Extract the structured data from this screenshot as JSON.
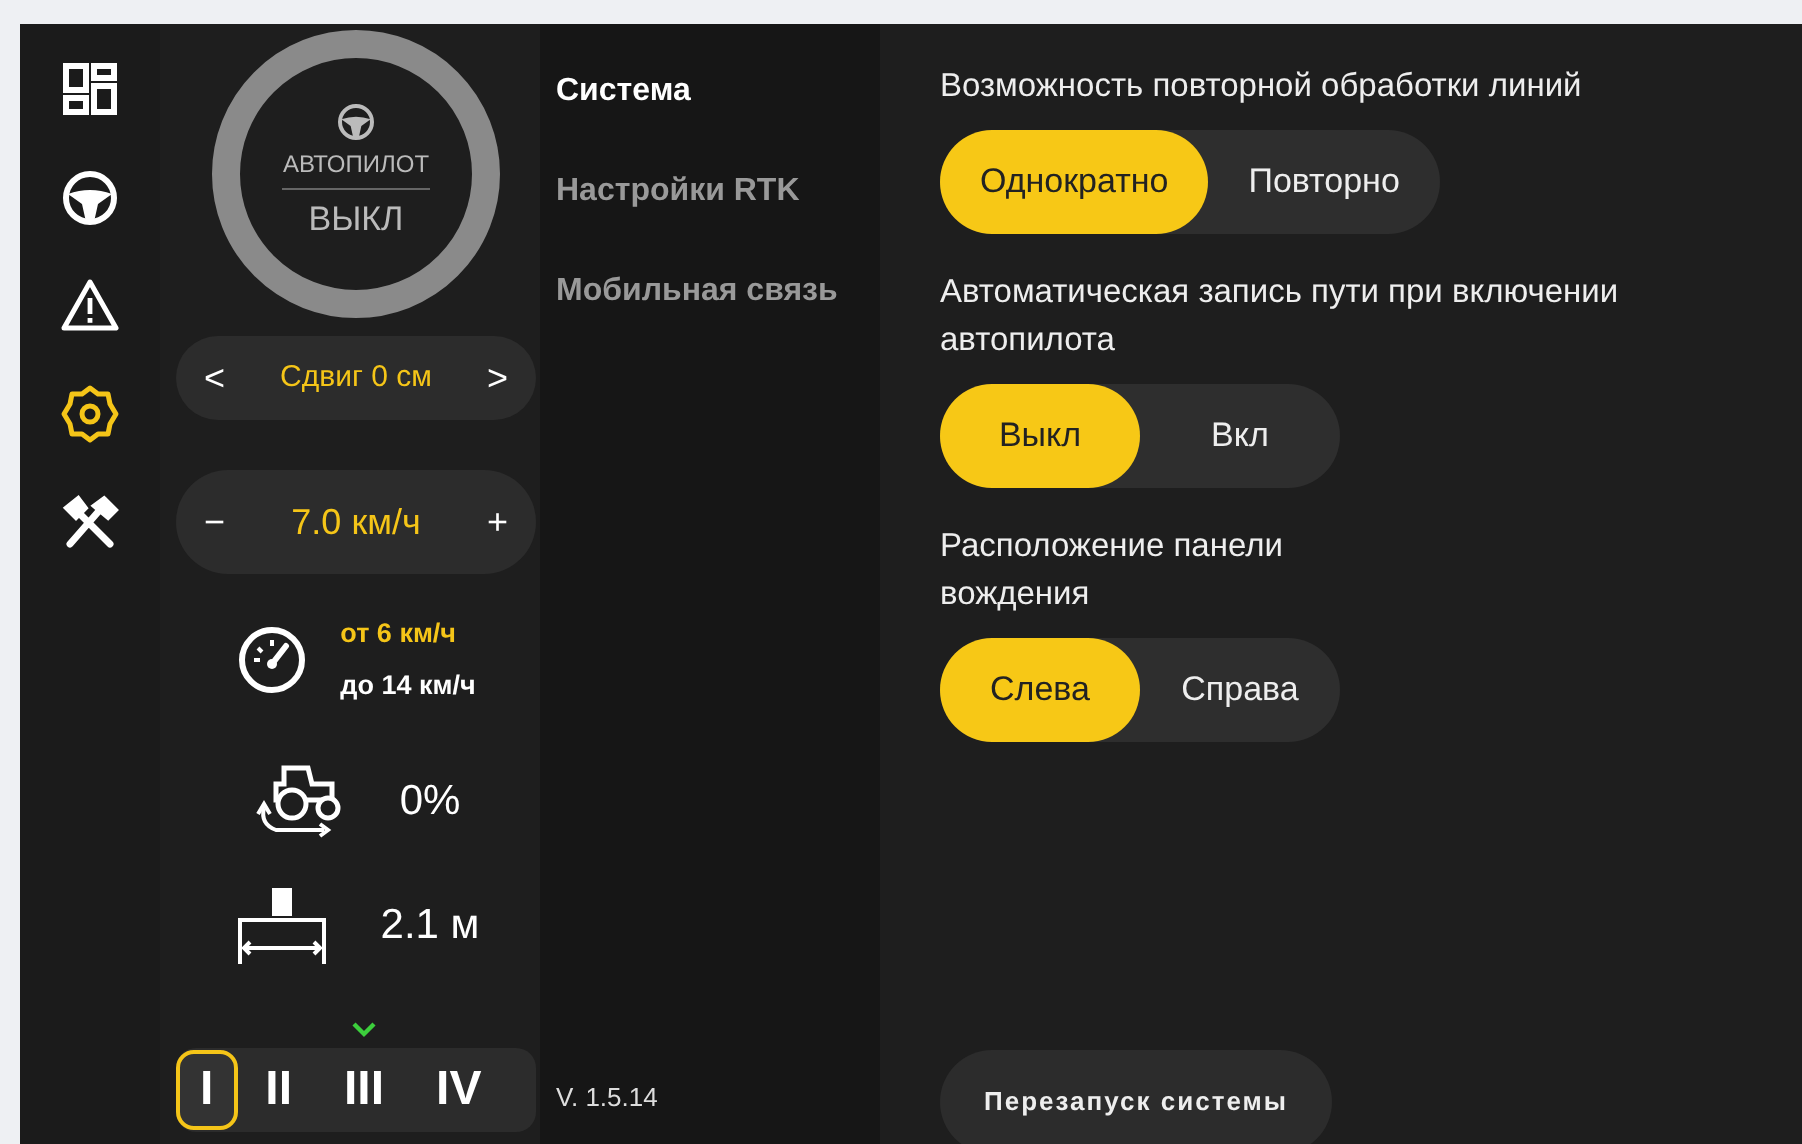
{
  "nav_rail": [
    {
      "kind": "dashboard",
      "selected": false
    },
    {
      "kind": "steering",
      "selected": false
    },
    {
      "kind": "warning",
      "selected": false
    },
    {
      "kind": "settings",
      "selected": true
    },
    {
      "kind": "tools",
      "selected": false
    }
  ],
  "autopilot": {
    "label": "АВТОПИЛОТ",
    "state": "ВЫКЛ"
  },
  "offset": {
    "prev": "<",
    "value": "Сдвиг 0 см",
    "next": ">"
  },
  "speed": {
    "minus": "−",
    "value": "7.0 км/ч",
    "plus": "+"
  },
  "speed_range": {
    "from": "от 6 км/ч",
    "to": "до 14 км/ч"
  },
  "slip": "0%",
  "implement_width": "2.1 м",
  "gears": [
    {
      "label": "I",
      "selected": true
    },
    {
      "label": "II",
      "selected": false
    },
    {
      "label": "III",
      "selected": false
    },
    {
      "label": "IV",
      "selected": false
    }
  ],
  "menu": [
    {
      "label": "Система",
      "selected": true
    },
    {
      "label": "Настройки RTK",
      "selected": false
    },
    {
      "label": "Мобильная связь",
      "selected": false
    }
  ],
  "version": "V. 1.5.14",
  "settings": [
    {
      "label": "Возможность повторной обработки линий",
      "options": [
        {
          "label": "Однократно",
          "selected": true
        },
        {
          "label": "Повторно",
          "selected": false
        }
      ]
    },
    {
      "label": "Автоматическая запись пути при включении автопилота",
      "options": [
        {
          "label": "Выкл",
          "selected": true
        },
        {
          "label": "Вкл",
          "selected": false
        }
      ]
    },
    {
      "label": "Расположение панели вождения",
      "options": [
        {
          "label": "Слева",
          "selected": true
        },
        {
          "label": "Справа",
          "selected": false
        }
      ]
    }
  ],
  "restart_button": "Перезапуск системы"
}
